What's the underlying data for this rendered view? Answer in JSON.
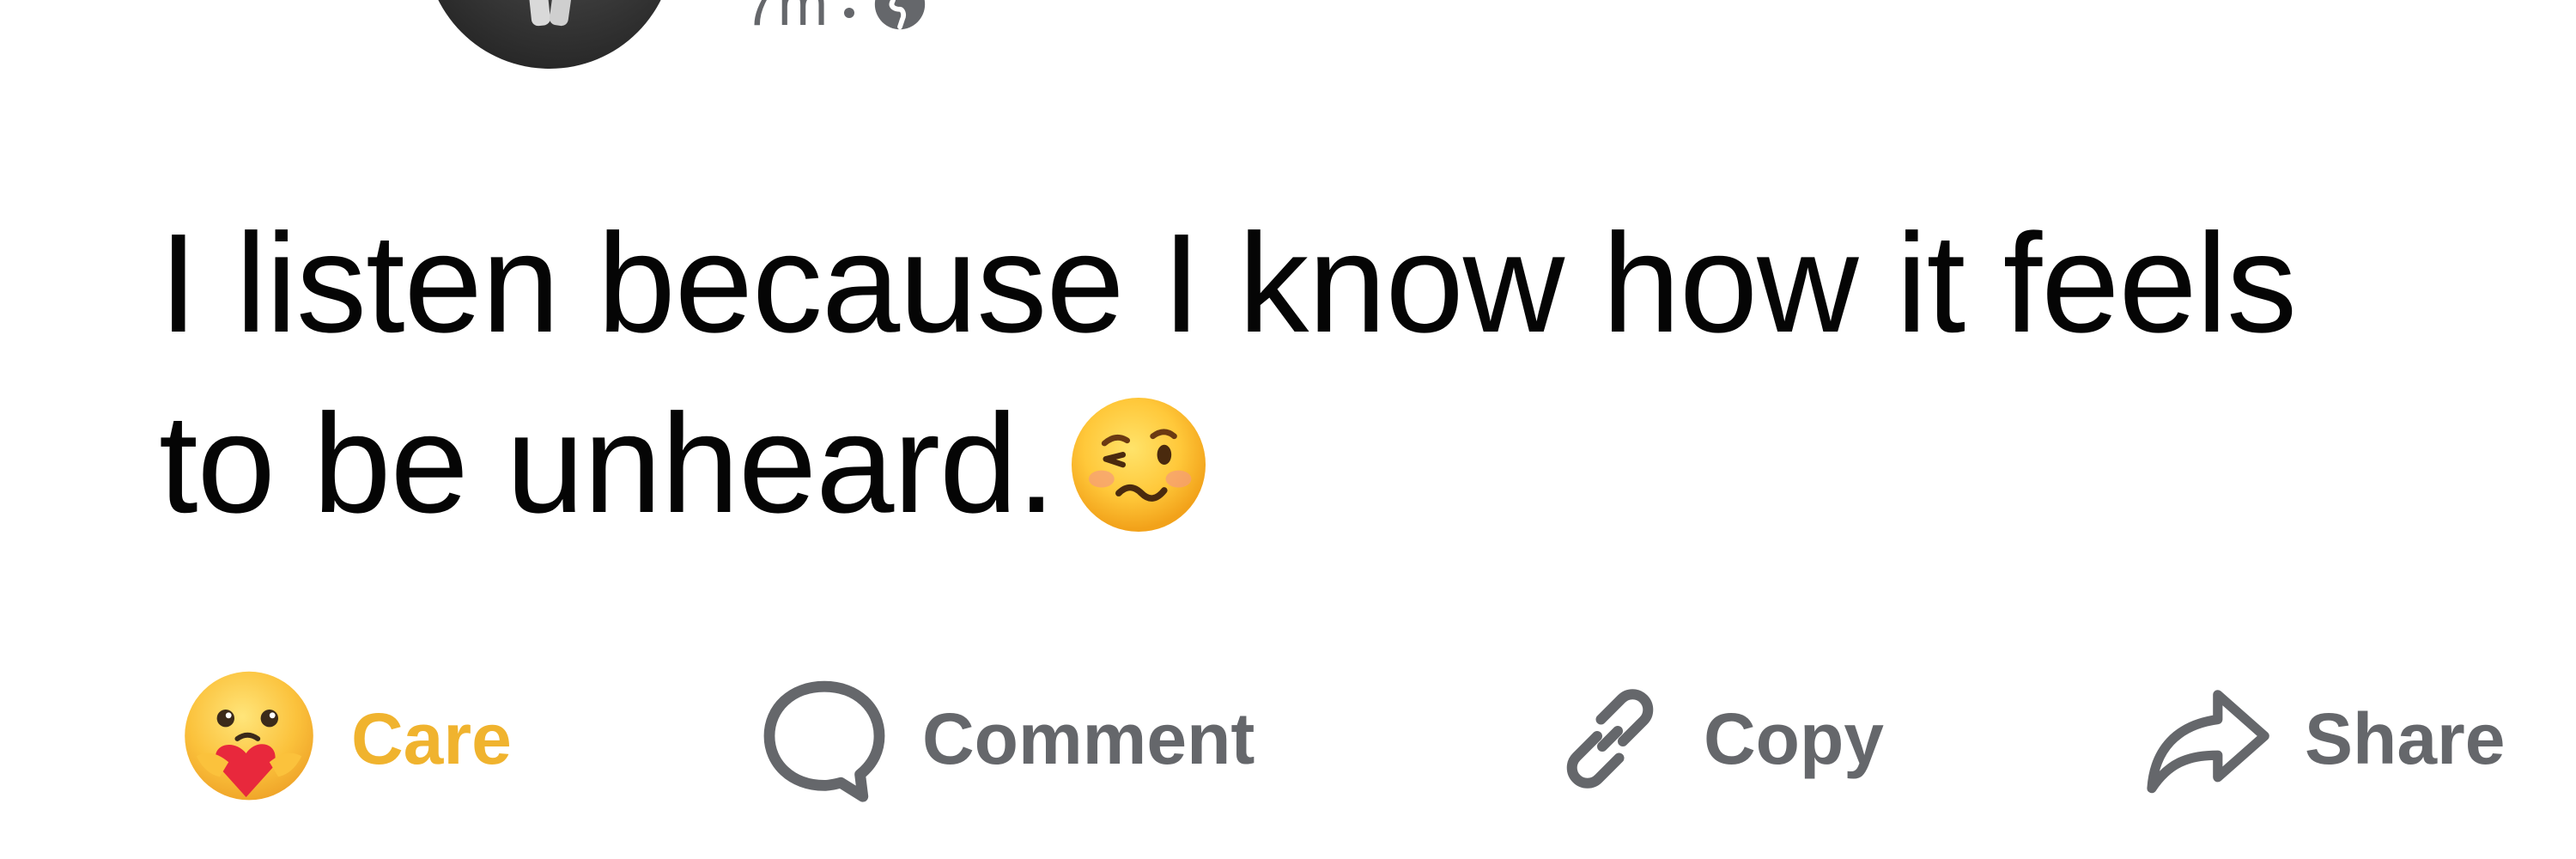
{
  "post": {
    "meta": {
      "time": "7m",
      "audience_icon": "globe-icon"
    },
    "text_lines": [
      "I listen because I know how it feels",
      "to be unheard."
    ],
    "emoji": "woozy-face-icon"
  },
  "actions": {
    "care": {
      "label": "Care",
      "icon": "care-hug-emoji-icon",
      "color": "#f0b32e"
    },
    "comment": {
      "label": "Comment",
      "icon": "comment-bubble-icon"
    },
    "copy": {
      "label": "Copy",
      "icon": "link-icon"
    },
    "share": {
      "label": "Share",
      "icon": "share-arrow-icon"
    }
  },
  "colors": {
    "text_primary": "#050505",
    "text_secondary": "#65676b",
    "care_accent": "#f0b32e"
  }
}
